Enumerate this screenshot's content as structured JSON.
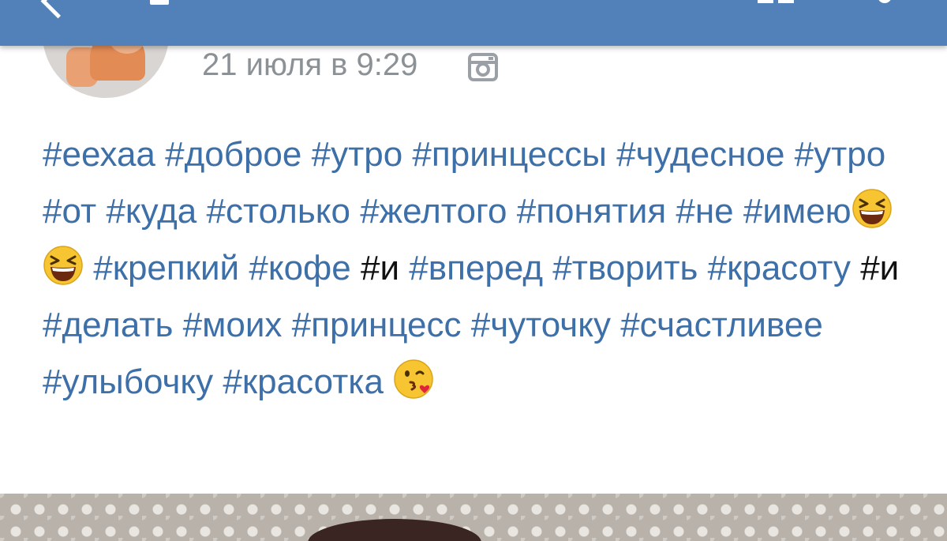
{
  "post": {
    "date": "21 июля в 9:29",
    "source_icon": "instagram-icon",
    "avatar_icon": "avatar",
    "tokens": [
      {
        "t": "#еехаа",
        "k": "tag"
      },
      {
        "t": " ",
        "k": "sp"
      },
      {
        "t": "#доброе",
        "k": "tag"
      },
      {
        "t": " ",
        "k": "sp"
      },
      {
        "t": "#утро",
        "k": "tag"
      },
      {
        "t": " ",
        "k": "sp"
      },
      {
        "t": "#принцессы",
        "k": "tag"
      },
      {
        "t": " ",
        "k": "sp"
      },
      {
        "t": "#чудесное",
        "k": "tag"
      },
      {
        "t": " ",
        "k": "sp"
      },
      {
        "t": "#утро",
        "k": "tag"
      },
      {
        "t": " ",
        "k": "sp"
      },
      {
        "t": "#от",
        "k": "tag"
      },
      {
        "t": " ",
        "k": "sp"
      },
      {
        "t": "#куда",
        "k": "tag"
      },
      {
        "t": " ",
        "k": "sp"
      },
      {
        "t": "#столько",
        "k": "tag"
      },
      {
        "t": " ",
        "k": "sp"
      },
      {
        "t": "#желтого",
        "k": "tag"
      },
      {
        "t": " ",
        "k": "sp"
      },
      {
        "t": "#понятия",
        "k": "tag"
      },
      {
        "t": " ",
        "k": "sp"
      },
      {
        "t": "#не",
        "k": "tag"
      },
      {
        "t": " ",
        "k": "sp"
      },
      {
        "t": "#имею",
        "k": "tag"
      },
      {
        "t": "laughing-emoji",
        "k": "emoji-laugh"
      },
      {
        "t": "laughing-emoji",
        "k": "emoji-laugh"
      },
      {
        "t": " ",
        "k": "sp"
      },
      {
        "t": "#крепкий",
        "k": "tag"
      },
      {
        "t": " ",
        "k": "sp"
      },
      {
        "t": "#кофе",
        "k": "tag"
      },
      {
        "t": " ",
        "k": "sp"
      },
      {
        "t": "#и",
        "k": "plain"
      },
      {
        "t": " ",
        "k": "sp"
      },
      {
        "t": "#вперед",
        "k": "tag"
      },
      {
        "t": " ",
        "k": "sp"
      },
      {
        "t": "#творить",
        "k": "tag"
      },
      {
        "t": " ",
        "k": "sp"
      },
      {
        "t": "#красоту",
        "k": "tag"
      },
      {
        "t": " ",
        "k": "sp"
      },
      {
        "t": "#и",
        "k": "plain"
      },
      {
        "t": " ",
        "k": "sp"
      },
      {
        "t": "#делать",
        "k": "tag"
      },
      {
        "t": " ",
        "k": "sp"
      },
      {
        "t": "#моих",
        "k": "tag"
      },
      {
        "t": " ",
        "k": "sp"
      },
      {
        "t": "#принцесс",
        "k": "tag"
      },
      {
        "t": " ",
        "k": "sp"
      },
      {
        "t": "#чуточку",
        "k": "tag"
      },
      {
        "t": " ",
        "k": "sp"
      },
      {
        "t": "#счастливее",
        "k": "tag"
      },
      {
        "t": " ",
        "k": "sp"
      },
      {
        "t": "#улыбочку",
        "k": "tag"
      },
      {
        "t": " ",
        "k": "sp"
      },
      {
        "t": "#красотка",
        "k": "tag"
      },
      {
        "t": " ",
        "k": "sp"
      },
      {
        "t": "kiss-emoji",
        "k": "emoji-kiss"
      }
    ]
  },
  "colors": {
    "header_bg": "#5181b8",
    "hashtag": "#3d6fa8",
    "date": "#8c9196",
    "plain_text": "#111111"
  },
  "icons": {
    "back": "back-arrow-icon",
    "action": "action-icon",
    "more": "more-icon"
  }
}
